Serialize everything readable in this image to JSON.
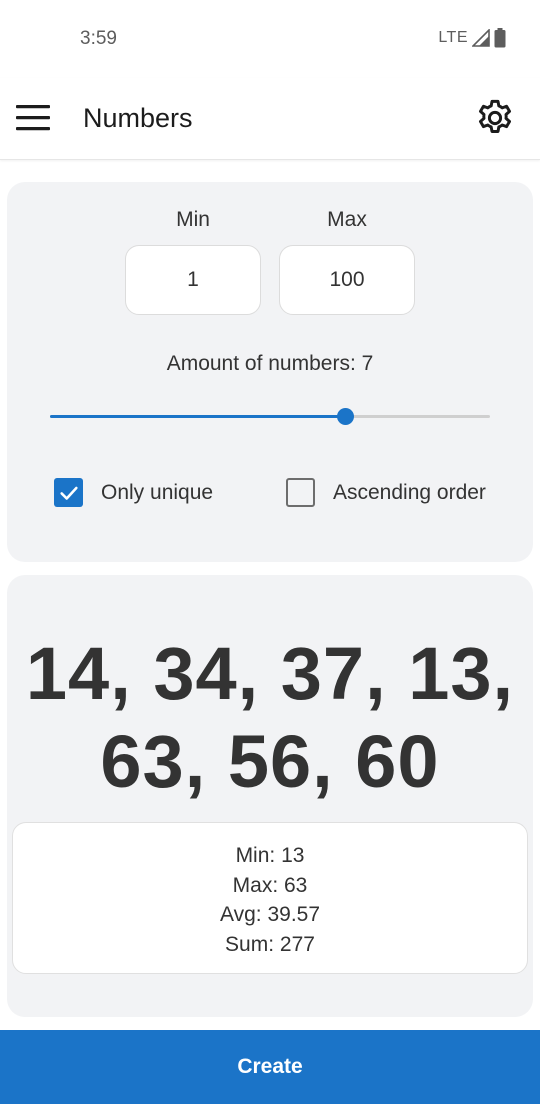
{
  "status_bar": {
    "time": "3:59",
    "network": "LTE",
    "icons": [
      "signal-icon",
      "battery-icon"
    ]
  },
  "app_bar": {
    "title": "Numbers",
    "menu_icon": "menu-icon",
    "settings_icon": "gear-icon"
  },
  "range": {
    "min_label": "Min",
    "min_value": "1",
    "max_label": "Max",
    "max_value": "100"
  },
  "amount": {
    "label": "Amount of numbers: 7",
    "slider_value": 0.67
  },
  "options": {
    "only_unique": {
      "label": "Only unique",
      "checked": true
    },
    "ascending": {
      "label": "Ascending order",
      "checked": false
    }
  },
  "result": {
    "numbers_line1": "14, 34, 37, 13,",
    "numbers_line2": "63, 56, 60",
    "stats": {
      "min": "Min: 13",
      "max": "Max: 63",
      "avg": "Avg: 39.57",
      "sum": "Sum: 277"
    }
  },
  "actions": {
    "create_label": "Create"
  },
  "colors": {
    "accent": "#1b74c8",
    "card_bg": "#f2f3f5",
    "text": "#333333"
  }
}
